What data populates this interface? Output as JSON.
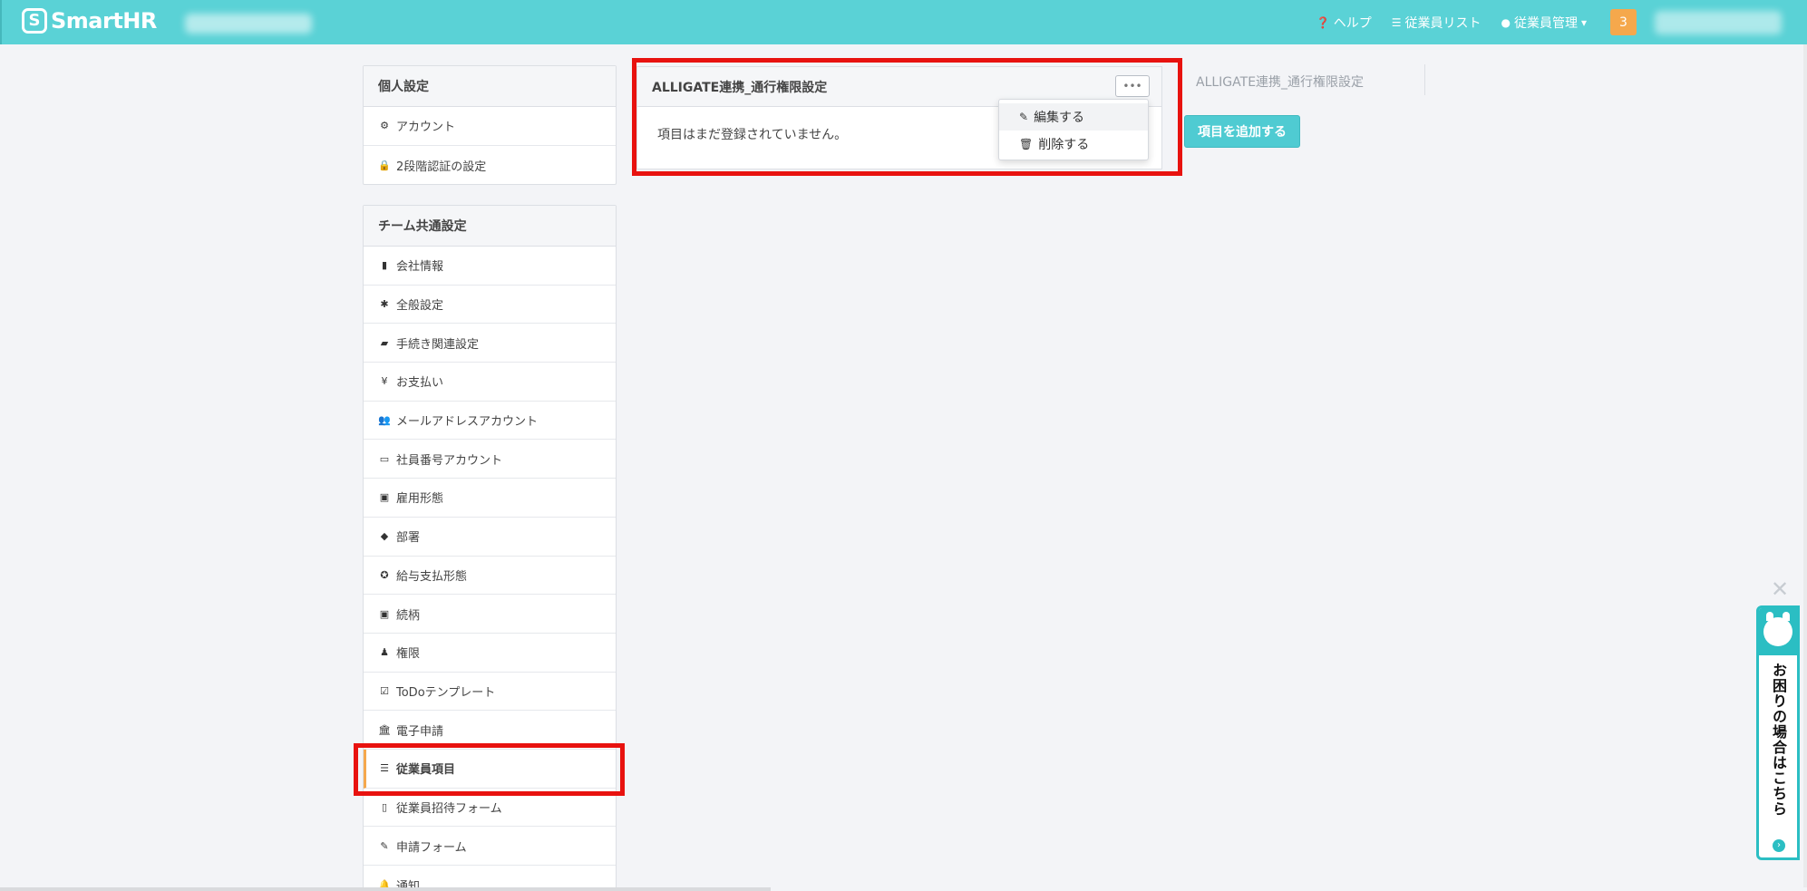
{
  "header": {
    "logo_mark": "S",
    "logo_text": "SmartHR",
    "help": "ヘルプ",
    "employee_list": "従業員リスト",
    "employee_mgmt": "従業員管理",
    "notification_count": "3"
  },
  "sidebar": {
    "personal": {
      "title": "個人設定",
      "items": [
        {
          "label": "アカウント",
          "icon": "gear-icon"
        },
        {
          "label": "2段階認証の設定",
          "icon": "lock-icon"
        }
      ]
    },
    "team": {
      "title": "チーム共通設定",
      "items": [
        {
          "label": "会社情報",
          "icon": "building-icon"
        },
        {
          "label": "全般設定",
          "icon": "asterisk-icon"
        },
        {
          "label": "手続き関連設定",
          "icon": "book-icon"
        },
        {
          "label": "お支払い",
          "icon": "yen-icon"
        },
        {
          "label": "メールアドレスアカウント",
          "icon": "users-icon"
        },
        {
          "label": "社員番号アカウント",
          "icon": "id-card-icon"
        },
        {
          "label": "雇用形態",
          "icon": "badge-icon"
        },
        {
          "label": "部署",
          "icon": "tags-icon"
        },
        {
          "label": "給与支払形態",
          "icon": "money-icon"
        },
        {
          "label": "続柄",
          "icon": "portrait-icon"
        },
        {
          "label": "権限",
          "icon": "user-key-icon"
        },
        {
          "label": "ToDoテンプレート",
          "icon": "checkbox-icon"
        },
        {
          "label": "電子申請",
          "icon": "institution-icon"
        },
        {
          "label": "従業員項目",
          "icon": "list-icon"
        },
        {
          "label": "従業員招待フォーム",
          "icon": "file-icon"
        },
        {
          "label": "申請フォーム",
          "icon": "file-edit-icon"
        },
        {
          "label": "通知",
          "icon": "bell-icon"
        }
      ]
    }
  },
  "main": {
    "card_title": "ALLIGATE連携_通行権限設定",
    "empty_message": "項目はまだ登録されていません。",
    "dropdown": {
      "edit": "編集する",
      "delete": "削除する"
    },
    "tab_label": "ALLIGATE連携_通行権限設定",
    "add_button": "項目を追加する"
  },
  "help_widget": {
    "text": "お困りの場合はこちら"
  },
  "colors": {
    "header": "#5ad2d6",
    "accent": "#4fcbd2",
    "badge": "#f5a84c",
    "highlight": "#e8120f"
  }
}
